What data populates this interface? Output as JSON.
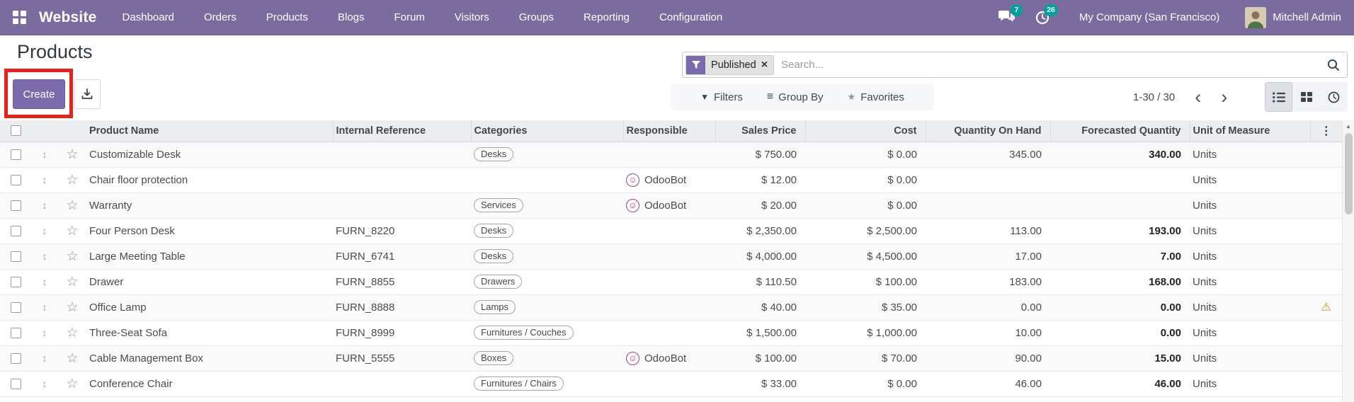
{
  "nav": {
    "brand": "Website",
    "items": [
      "Dashboard",
      "Orders",
      "Products",
      "Blogs",
      "Forum",
      "Visitors",
      "Groups",
      "Reporting",
      "Configuration"
    ],
    "messages_badge": "7",
    "activities_badge": "26",
    "company": "My Company (San Francisco)",
    "user": "Mitchell Admin",
    "colors": {
      "bg": "#7a6c9e",
      "badge": "#00a09d"
    }
  },
  "page": {
    "title": "Products"
  },
  "actions": {
    "create": "Create"
  },
  "search": {
    "facet": "Published",
    "placeholder": "Search...",
    "remove": "×"
  },
  "toolbar": {
    "filters": "Filters",
    "group_by": "Group By",
    "favorites": "Favorites",
    "pager_range": "1-30 / 30",
    "chevron_left": "‹",
    "chevron_right": "›"
  },
  "icons": {
    "drag_handle": "↕",
    "star": "☆",
    "smiley": "☺",
    "warning": "⚠",
    "column_options": "⋮",
    "scroll_up": "▲",
    "group_by": "≡",
    "favorites_star": "★",
    "filters_funnel": "▼"
  },
  "table": {
    "headers": [
      "Product Name",
      "Internal Reference",
      "Categories",
      "Responsible",
      "Sales Price",
      "Cost",
      "Quantity On Hand",
      "Forecasted Quantity",
      "Unit of Measure"
    ],
    "rows": [
      {
        "name": "Customizable Desk",
        "ref": "",
        "category": "Desks",
        "responsible": "",
        "sales": "$ 750.00",
        "cost": "$ 0.00",
        "qty": "345.00",
        "forecast": "340.00",
        "uom": "Units",
        "warning": false
      },
      {
        "name": "Chair floor protection",
        "ref": "",
        "category": "",
        "responsible": "OdooBot",
        "sales": "$ 12.00",
        "cost": "$ 0.00",
        "qty": "",
        "forecast": "",
        "uom": "Units",
        "warning": false
      },
      {
        "name": "Warranty",
        "ref": "",
        "category": "Services",
        "responsible": "OdooBot",
        "sales": "$ 20.00",
        "cost": "$ 0.00",
        "qty": "",
        "forecast": "",
        "uom": "Units",
        "warning": false
      },
      {
        "name": "Four Person Desk",
        "ref": "FURN_8220",
        "category": "Desks",
        "responsible": "",
        "sales": "$ 2,350.00",
        "cost": "$ 2,500.00",
        "qty": "113.00",
        "forecast": "193.00",
        "uom": "Units",
        "warning": false
      },
      {
        "name": "Large Meeting Table",
        "ref": "FURN_6741",
        "category": "Desks",
        "responsible": "",
        "sales": "$ 4,000.00",
        "cost": "$ 4,500.00",
        "qty": "17.00",
        "forecast": "7.00",
        "uom": "Units",
        "warning": false
      },
      {
        "name": "Drawer",
        "ref": "FURN_8855",
        "category": "Drawers",
        "responsible": "",
        "sales": "$ 110.50",
        "cost": "$ 100.00",
        "qty": "183.00",
        "forecast": "168.00",
        "uom": "Units",
        "warning": false
      },
      {
        "name": "Office Lamp",
        "ref": "FURN_8888",
        "category": "Lamps",
        "responsible": "",
        "sales": "$ 40.00",
        "cost": "$ 35.00",
        "qty": "0.00",
        "forecast": "0.00",
        "uom": "Units",
        "warning": true
      },
      {
        "name": "Three-Seat Sofa",
        "ref": "FURN_8999",
        "category": "Furnitures / Couches",
        "responsible": "",
        "sales": "$ 1,500.00",
        "cost": "$ 1,000.00",
        "qty": "10.00",
        "forecast": "0.00",
        "uom": "Units",
        "warning": false
      },
      {
        "name": "Cable Management Box",
        "ref": "FURN_5555",
        "category": "Boxes",
        "responsible": "OdooBot",
        "sales": "$ 100.00",
        "cost": "$ 70.00",
        "qty": "90.00",
        "forecast": "15.00",
        "uom": "Units",
        "warning": false
      },
      {
        "name": "Conference Chair",
        "ref": "",
        "category": "Furnitures / Chairs",
        "responsible": "",
        "sales": "$ 33.00",
        "cost": "$ 0.00",
        "qty": "46.00",
        "forecast": "46.00",
        "uom": "Units",
        "warning": false
      }
    ]
  }
}
